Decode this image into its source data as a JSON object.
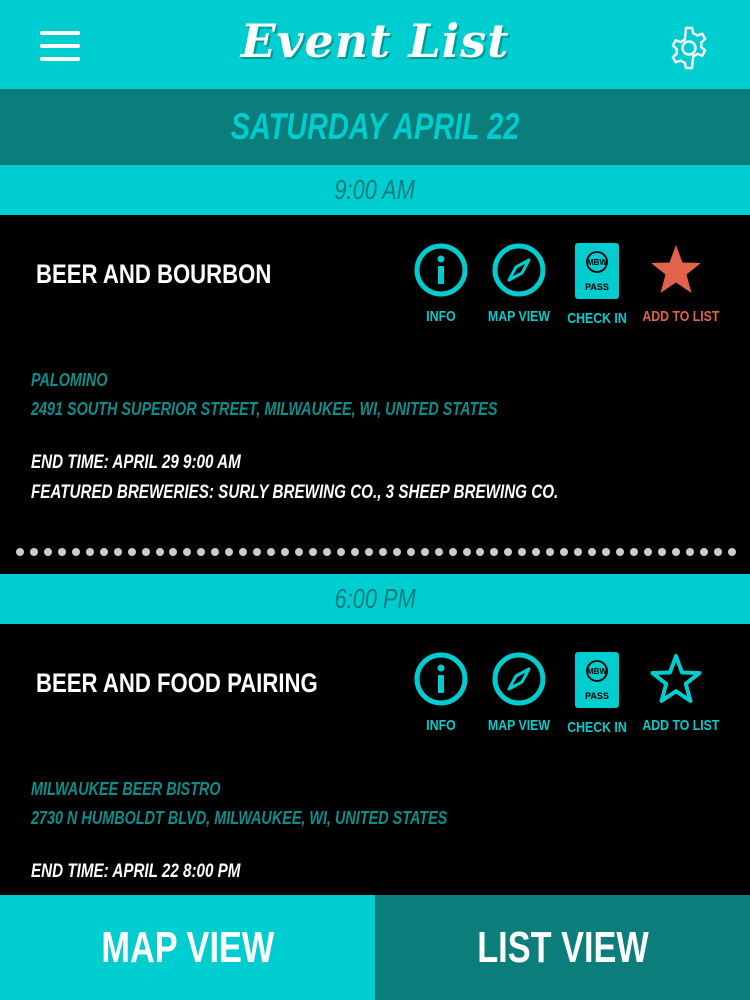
{
  "header": {
    "title": "Event List",
    "menu_icon": "hamburger-menu-icon",
    "settings_icon": "gear-icon"
  },
  "date_header": "SATURDAY APRIL 22",
  "events": [
    {
      "time": "9:00 AM",
      "name": "BEER AND BOURBON",
      "venue": "PALOMINO",
      "address": "2491 SOUTH SUPERIOR STREET, MILWAUKEE, WI, UNITED STATES",
      "end_time": "END TIME: APRIL 29 9:00 AM",
      "featured": "FEATURED BREWERIES: SURLY BREWING CO., 3 SHEEP BREWING CO.",
      "added_to_list": true
    },
    {
      "time": "6:00 PM",
      "name": "BEER AND FOOD PAIRING",
      "venue": "MILWAUKEE BEER BISTRO",
      "address": "2730 N HUMBOLDT BLVD, MILWAUKEE, WI, UNITED STATES",
      "end_time": "END TIME: APRIL 22 8:00 PM",
      "added_to_list": false
    }
  ],
  "actions": {
    "info": "INFO",
    "map_view": "MAP VIEW",
    "check_in": "CHECK IN",
    "add_to_list": "ADD TO LIST",
    "pass_top": "MBW",
    "pass_bottom": "PASS"
  },
  "bottom_tabs": {
    "map": "MAP VIEW",
    "list": "LIST VIEW"
  },
  "colors": {
    "accent": "#00cdcf",
    "dark_teal": "#0b7e7c",
    "starred": "#e2634b",
    "background": "#000000"
  }
}
